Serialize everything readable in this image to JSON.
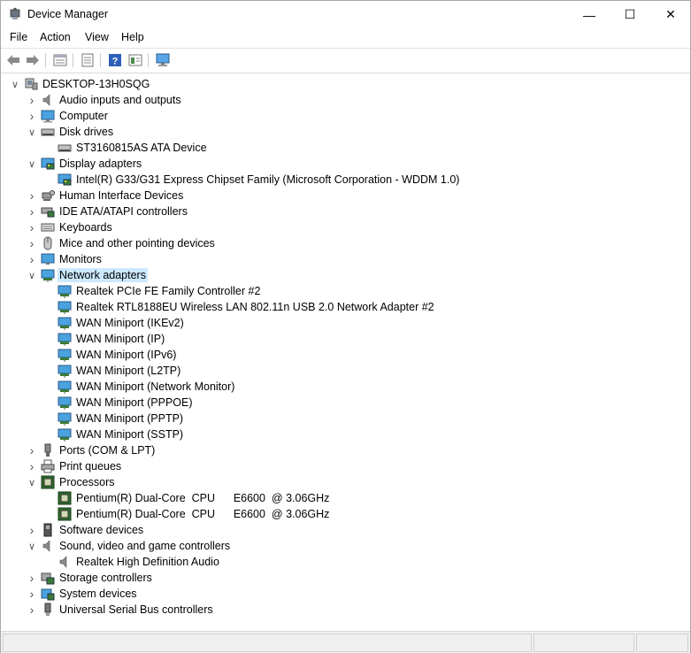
{
  "window": {
    "title": "Device Manager",
    "controls": {
      "minimize": "—",
      "maximize": "☐",
      "close": "✕"
    }
  },
  "menu": [
    "File",
    "Action",
    "View",
    "Help"
  ],
  "toolbar": [
    {
      "name": "back-arrow-icon"
    },
    {
      "name": "forward-arrow-icon"
    },
    {
      "name": "properties-icon"
    },
    {
      "name": "list-view-icon"
    },
    {
      "name": "help-icon"
    },
    {
      "name": "details-icon"
    },
    {
      "name": "monitor-scan-icon"
    }
  ],
  "tree": {
    "root": "DESKTOP-13H0SQG",
    "categories": [
      {
        "label": "Audio inputs and outputs",
        "icon": "speaker-icon",
        "expanded": false,
        "children": []
      },
      {
        "label": "Computer",
        "icon": "computer-icon",
        "expanded": false,
        "children": []
      },
      {
        "label": "Disk drives",
        "icon": "disk-drive-icon",
        "expanded": true,
        "children": [
          "ST3160815AS ATA Device"
        ]
      },
      {
        "label": "Display adapters",
        "icon": "display-adapter-icon",
        "expanded": true,
        "children": [
          "Intel(R) G33/G31 Express Chipset Family (Microsoft Corporation - WDDM 1.0)"
        ]
      },
      {
        "label": "Human Interface Devices",
        "icon": "hid-icon",
        "expanded": false,
        "children": []
      },
      {
        "label": "IDE ATA/ATAPI controllers",
        "icon": "ide-controller-icon",
        "expanded": false,
        "children": []
      },
      {
        "label": "Keyboards",
        "icon": "keyboard-icon",
        "expanded": false,
        "children": []
      },
      {
        "label": "Mice and other pointing devices",
        "icon": "mouse-icon",
        "expanded": false,
        "children": []
      },
      {
        "label": "Monitors",
        "icon": "monitor-icon",
        "expanded": false,
        "children": []
      },
      {
        "label": "Network adapters",
        "icon": "network-adapter-icon",
        "expanded": true,
        "selected": true,
        "children": [
          "Realtek PCIe FE Family Controller #2",
          "Realtek RTL8188EU Wireless LAN 802.11n USB 2.0 Network Adapter #2",
          "WAN Miniport (IKEv2)",
          "WAN Miniport (IP)",
          "WAN Miniport (IPv6)",
          "WAN Miniport (L2TP)",
          "WAN Miniport (Network Monitor)",
          "WAN Miniport (PPPOE)",
          "WAN Miniport (PPTP)",
          "WAN Miniport (SSTP)"
        ]
      },
      {
        "label": "Ports (COM & LPT)",
        "icon": "port-icon",
        "expanded": false,
        "children": []
      },
      {
        "label": "Print queues",
        "icon": "printer-icon",
        "expanded": false,
        "children": []
      },
      {
        "label": "Processors",
        "icon": "processor-icon",
        "expanded": true,
        "children": [
          "Pentium(R) Dual-Core  CPU      E6600  @ 3.06GHz",
          "Pentium(R) Dual-Core  CPU      E6600  @ 3.06GHz"
        ]
      },
      {
        "label": "Software devices",
        "icon": "software-device-icon",
        "expanded": false,
        "children": []
      },
      {
        "label": "Sound, video and game controllers",
        "icon": "speaker-icon",
        "expanded": true,
        "children": [
          "Realtek High Definition Audio"
        ]
      },
      {
        "label": "Storage controllers",
        "icon": "storage-controller-icon",
        "expanded": false,
        "children": []
      },
      {
        "label": "System devices",
        "icon": "system-device-icon",
        "expanded": false,
        "children": []
      },
      {
        "label": "Universal Serial Bus controllers",
        "icon": "usb-icon",
        "expanded": false,
        "children": []
      }
    ]
  }
}
